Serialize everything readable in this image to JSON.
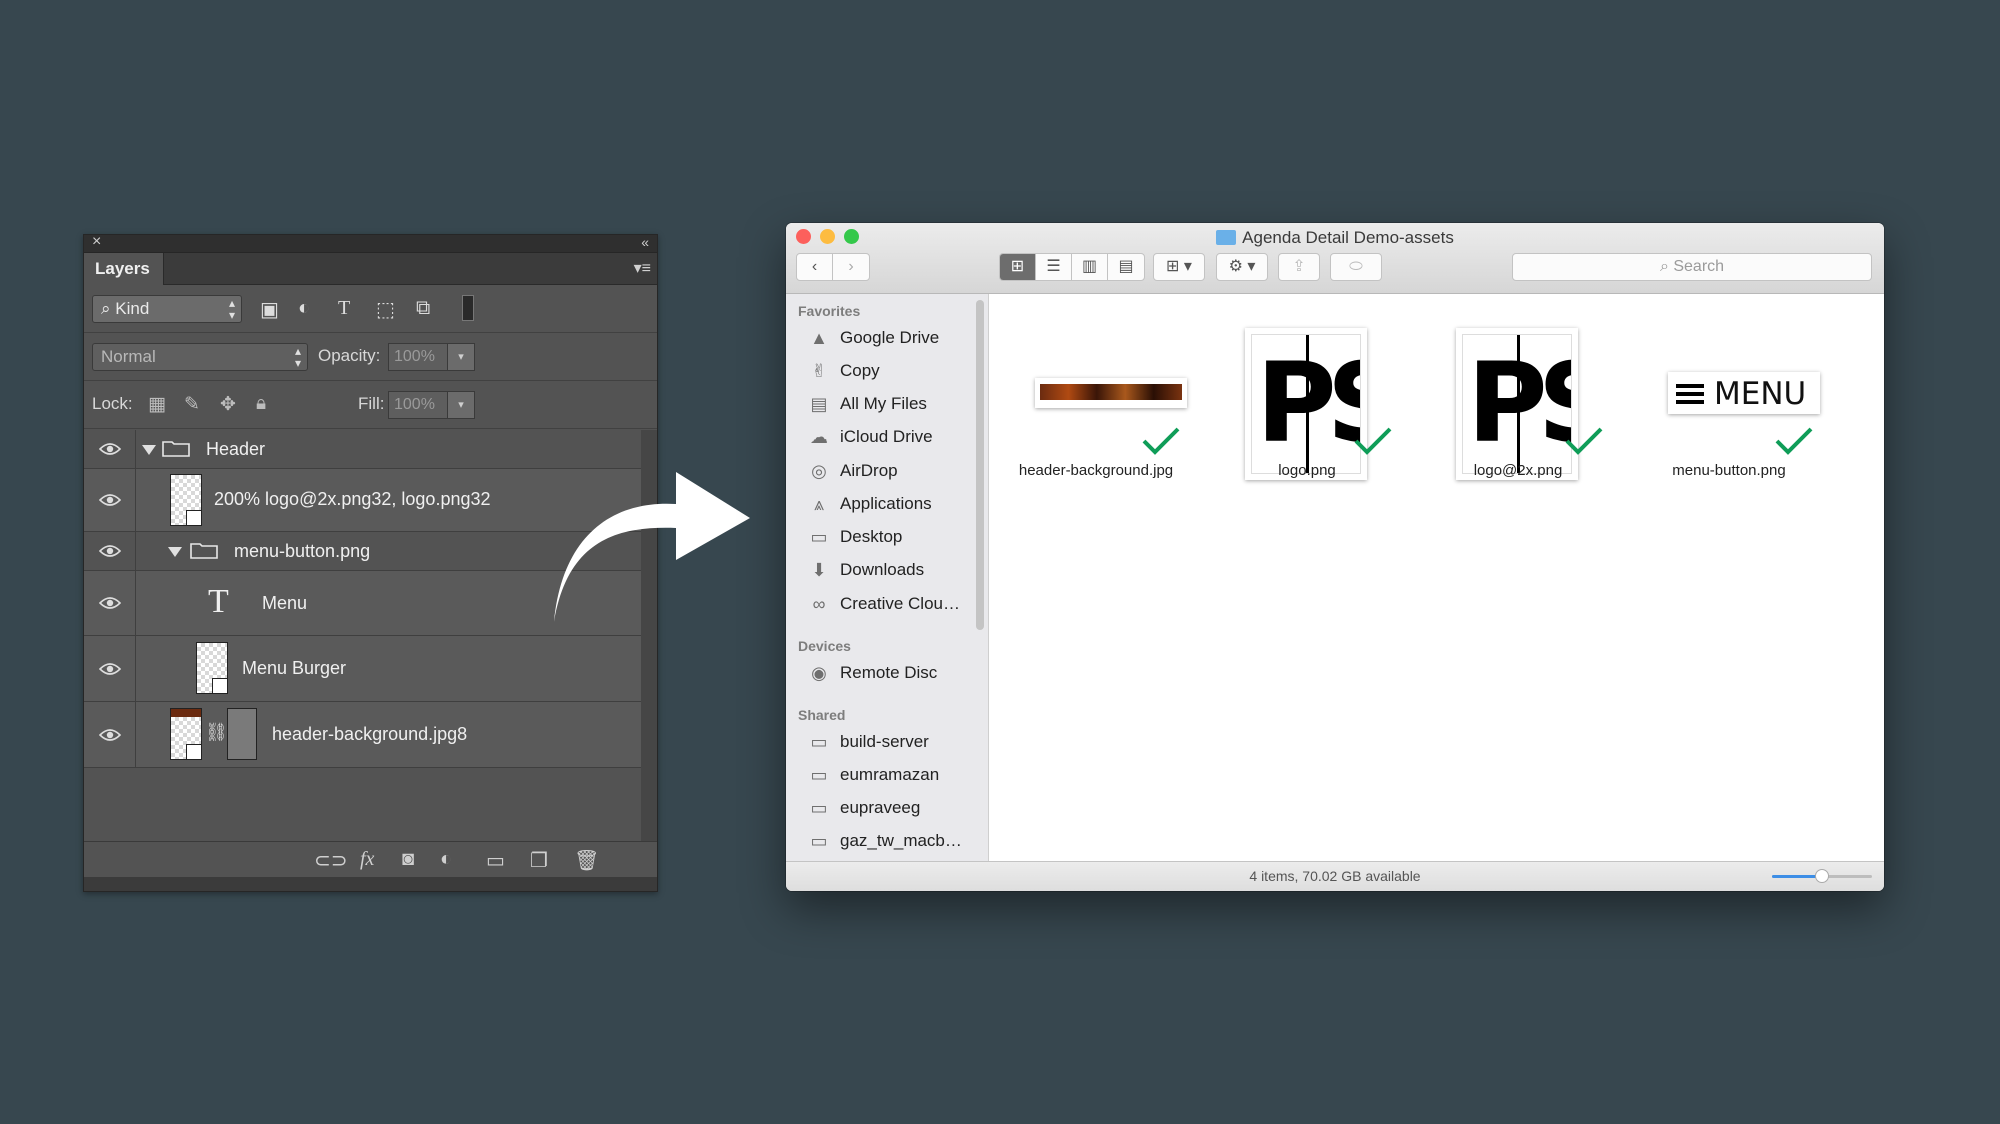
{
  "photoshop": {
    "panel_tab": "Layers",
    "close_glyph": "×",
    "collapse_glyph": "«",
    "panel_menu_glyph": "≡",
    "filter": {
      "label": "Kind"
    },
    "blend_mode": "Normal",
    "opacity": {
      "label": "Opacity:",
      "value": "100%"
    },
    "lock": {
      "label": "Lock:"
    },
    "fill": {
      "label": "Fill:",
      "value": "100%"
    },
    "layers": [
      {
        "name": "Header",
        "kind": "group",
        "expanded": true
      },
      {
        "name": "200% logo@2x.png32, logo.png32",
        "kind": "smart-object"
      },
      {
        "name": "menu-button.png",
        "kind": "group",
        "expanded": true
      },
      {
        "name": "Menu",
        "kind": "text"
      },
      {
        "name": "Menu Burger",
        "kind": "smart-object"
      },
      {
        "name": "header-background.jpg8",
        "kind": "masked-smart-object"
      }
    ],
    "bottom_icons": [
      "link-icon",
      "fx-icon",
      "mask-icon",
      "adjustment-icon",
      "folder-icon",
      "new-layer-icon",
      "trash-icon"
    ],
    "fx_label": "fx"
  },
  "finder": {
    "window_title": "Agenda Detail Demo-assets",
    "search_placeholder": "Search",
    "sidebar": {
      "favorites_heading": "Favorites",
      "favorites": [
        {
          "label": "Google Drive",
          "icon": "google-drive-icon"
        },
        {
          "label": "Copy",
          "icon": "copy-icon"
        },
        {
          "label": "All My Files",
          "icon": "all-files-icon"
        },
        {
          "label": "iCloud Drive",
          "icon": "icloud-icon"
        },
        {
          "label": "AirDrop",
          "icon": "airdrop-icon"
        },
        {
          "label": "Applications",
          "icon": "applications-icon"
        },
        {
          "label": "Desktop",
          "icon": "desktop-icon"
        },
        {
          "label": "Downloads",
          "icon": "downloads-icon"
        },
        {
          "label": "Creative Clou…",
          "icon": "creative-cloud-icon"
        }
      ],
      "devices_heading": "Devices",
      "devices": [
        {
          "label": "Remote Disc",
          "icon": "disc-icon"
        }
      ],
      "shared_heading": "Shared",
      "shared": [
        {
          "label": "build-server",
          "icon": "computer-icon"
        },
        {
          "label": "eumramazan",
          "icon": "computer-icon"
        },
        {
          "label": "eupraveeg",
          "icon": "computer-icon"
        },
        {
          "label": "gaz_tw_macb…",
          "icon": "computer-icon"
        }
      ]
    },
    "files": [
      {
        "name": "header-background.jpg",
        "synced": true
      },
      {
        "name": "logo.png",
        "synced": true
      },
      {
        "name": "logo@2x.png",
        "synced": true
      },
      {
        "name": "menu-button.png",
        "synced": true,
        "thumb_text": "MENU"
      }
    ],
    "logo_text": "PS",
    "status_text": "4 items, 70.02 GB available",
    "zoom_level": 0.5,
    "colors": {
      "close": "#fc605c",
      "minimize": "#fdbc40",
      "zoom": "#34c84a",
      "check": "#0f9d58",
      "accent": "#3d8ee6"
    }
  }
}
